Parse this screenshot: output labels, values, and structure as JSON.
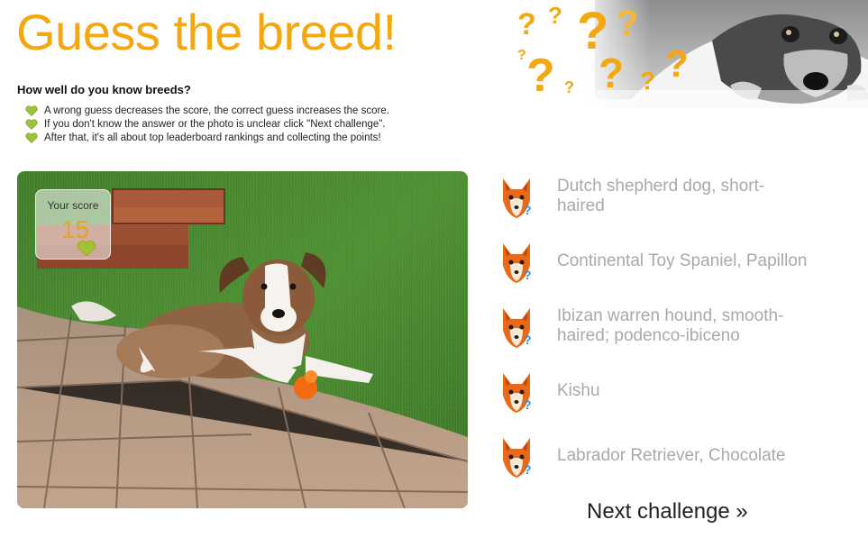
{
  "page": {
    "title": "Guess the breed!"
  },
  "intro": {
    "heading": "How well do you know breeds?",
    "rules": [
      "A wrong guess decreases the score, the correct guess increases the score.",
      "If you don't know the answer or the photo is unclear click \"Next challenge\".",
      "After that, it's all about top leaderboard rankings and collecting the points!"
    ]
  },
  "score": {
    "label": "Your score",
    "value": "15"
  },
  "answers": [
    "Dutch shepherd dog, short-haired",
    "Continental Toy Spaniel, Papillon",
    "Ibizan warren hound, smooth-haired; podenco-ibiceno",
    "Kishu",
    "Labrador Retriever, Chocolate"
  ],
  "next_challenge": "Next challenge »",
  "colors": {
    "accent": "#f5a70f",
    "answer_text": "#a9a9a9",
    "heart": "#9bc43a"
  }
}
